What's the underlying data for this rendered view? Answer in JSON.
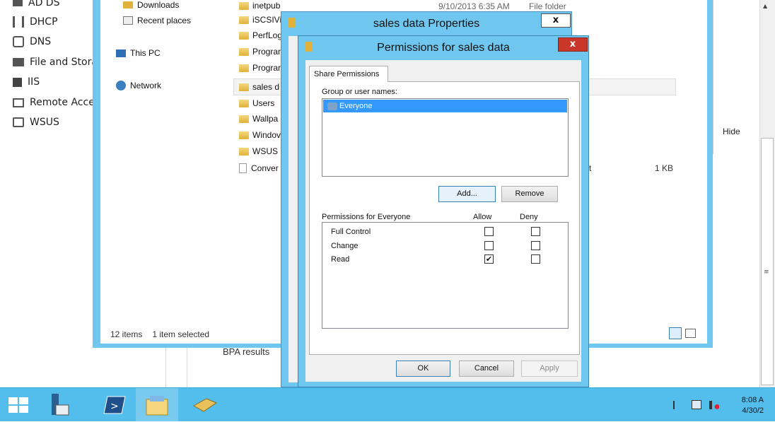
{
  "server_manager": {
    "sidebar_items": [
      "AD DS",
      "DHCP",
      "DNS",
      "File and Stora",
      "IIS",
      "Remote Acce",
      "WSUS"
    ],
    "hide_label": "Hide",
    "bpa_label": "BPA results"
  },
  "explorer": {
    "nav_items": {
      "downloads": "Downloads",
      "recent": "Recent places",
      "this_pc": "This PC",
      "network": "Network"
    },
    "files": [
      "inetpub",
      "iSCSIVi",
      "PerfLog",
      "Prograr",
      "Prograr",
      "sales d",
      "Users",
      "Wallpa",
      "Windov",
      "WSUS",
      "Conver"
    ],
    "first_row_date": "9/10/2013 6:35 AM",
    "first_row_type": "File folder",
    "partial_t": "t",
    "size_value": "1 KB",
    "status_items": "12 items",
    "status_selected": "1 item selected"
  },
  "properties_dialog": {
    "title": "sales data Properties",
    "close_label": "x"
  },
  "permissions_dialog": {
    "title": "Permissions for sales data",
    "close_label": "x",
    "tab_label": "Share Permissions",
    "group_label": "Group or user names:",
    "selected_user": "Everyone",
    "add_label": "Add...",
    "remove_label": "Remove",
    "perm_header": "Permissions for Everyone",
    "allow_header": "Allow",
    "deny_header": "Deny",
    "permissions": [
      {
        "name": "Full Control",
        "allow": false,
        "deny": false
      },
      {
        "name": "Change",
        "allow": false,
        "deny": false
      },
      {
        "name": "Read",
        "allow": true,
        "deny": false
      }
    ],
    "ok_label": "OK",
    "cancel_label": "Cancel",
    "apply_label": "Apply"
  },
  "taskbar": {
    "time": "8:08 A",
    "date": "4/30/2"
  }
}
